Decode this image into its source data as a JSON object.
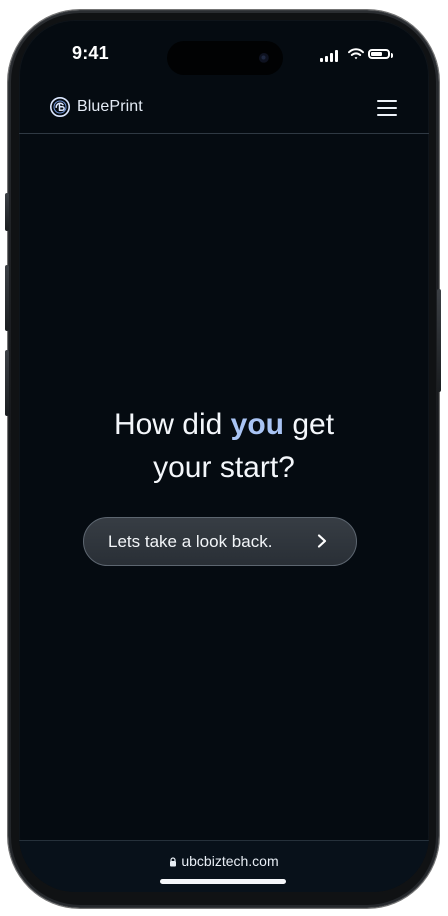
{
  "status_bar": {
    "time": "9:41",
    "icons": [
      "signal-icon",
      "wifi-icon",
      "battery-icon"
    ],
    "battery_level": 0.82
  },
  "header": {
    "brand_name": "BluePrint",
    "logo_icon": "blueprint-logo-icon",
    "menu_icon": "hamburger-menu-icon"
  },
  "hero": {
    "headline_line1_prefix": "How did ",
    "headline_accent": "you",
    "headline_line1_suffix": " get",
    "headline_line2": "your start?"
  },
  "cta": {
    "label": "Lets take a look back.",
    "icon": "chevron-right-icon"
  },
  "browser": {
    "url": "ubcbiztech.com",
    "lock_icon": "lock-icon"
  },
  "colors": {
    "background": "#050b11",
    "accent": "#a9c4f4",
    "button_background": "#303740",
    "text": "#f4f7fb"
  }
}
